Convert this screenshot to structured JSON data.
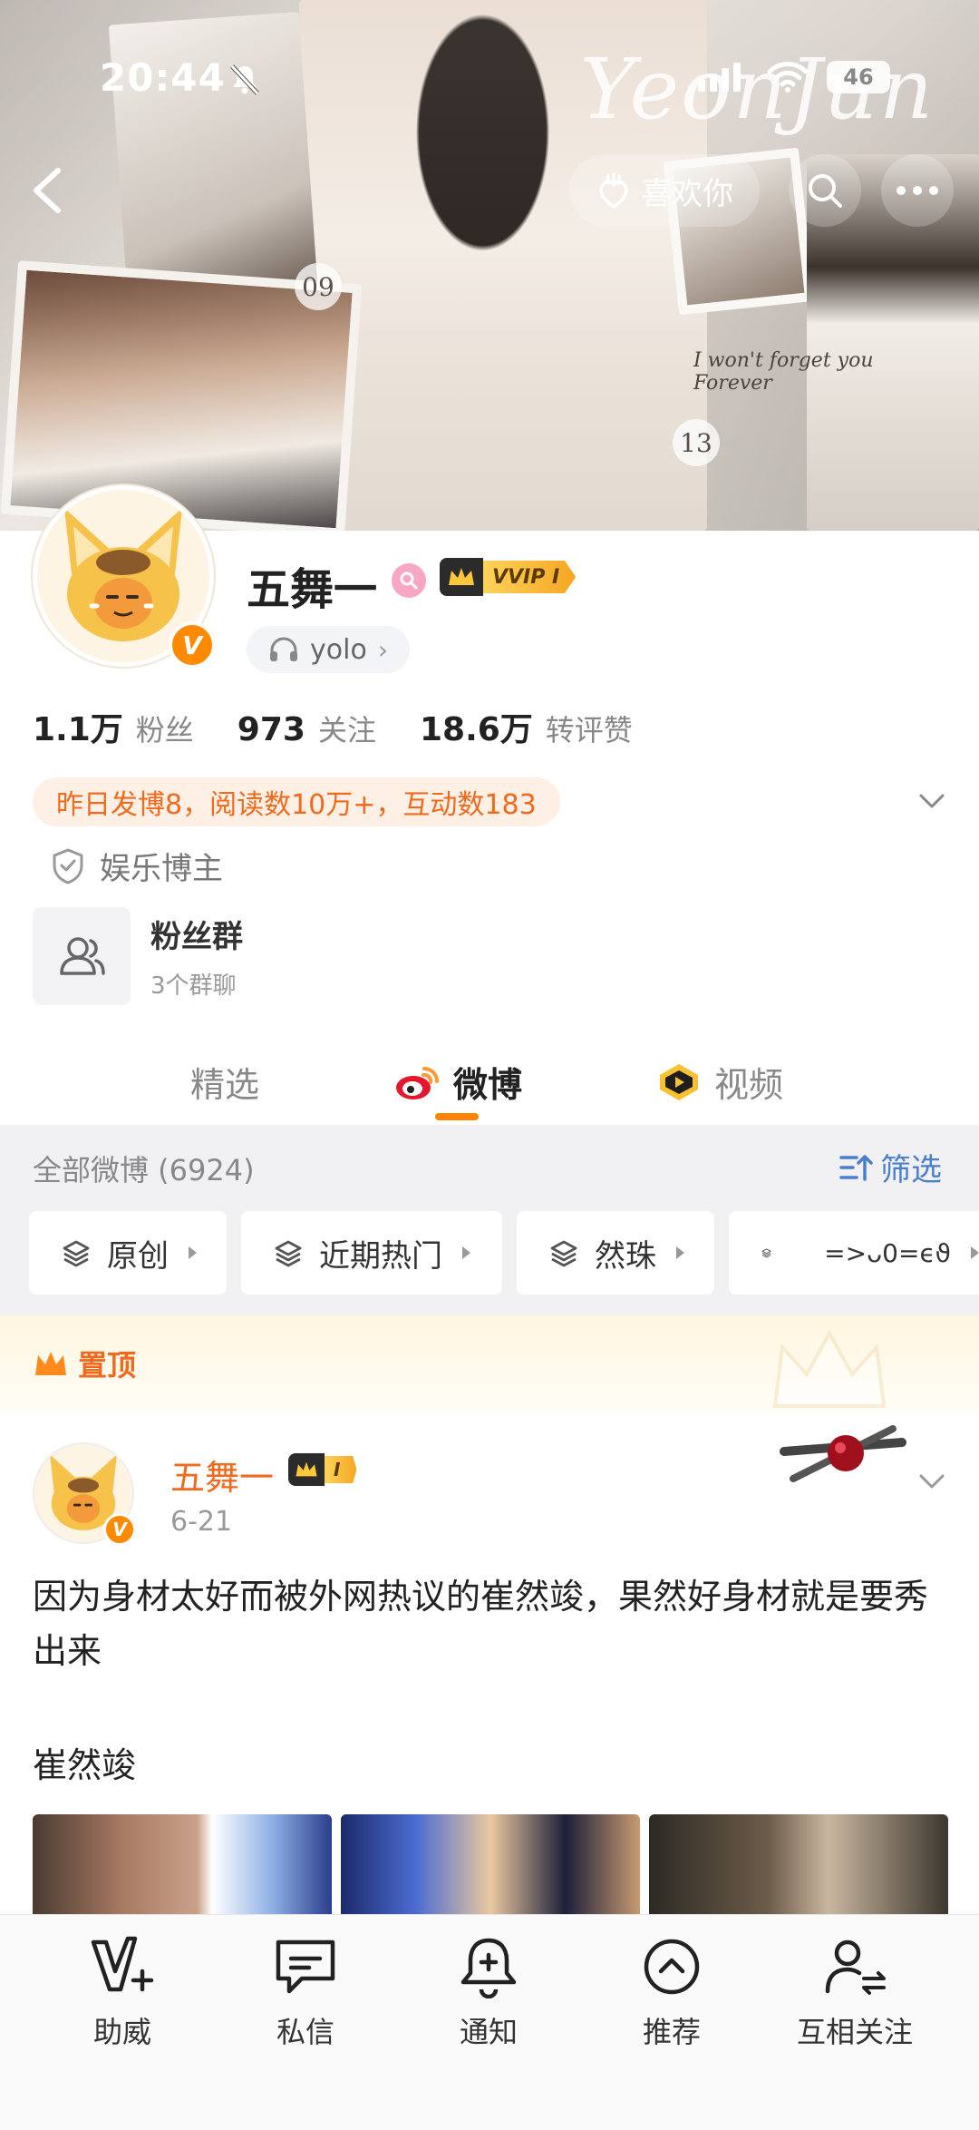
{
  "status_bar": {
    "time": "20:44",
    "battery": "46"
  },
  "banner": {
    "signature": "YeonJun",
    "number_left": "09",
    "number_right": "13",
    "caption": "I won't forget you Forever"
  },
  "header": {
    "like_label": "喜欢你"
  },
  "profile": {
    "name": "五舞一",
    "vip_label": "VVIP I",
    "music_chip": "yolo",
    "stats": [
      {
        "value": "1.1万",
        "label": "粉丝"
      },
      {
        "value": "973",
        "label": "关注"
      },
      {
        "value": "18.6万",
        "label": "转评赞"
      }
    ],
    "activity": "昨日发博8，阅读数10万+，互动数183",
    "role": "娱乐博主",
    "fans_group": {
      "title": "粉丝群",
      "subtitle": "3个群聊"
    }
  },
  "tabs": [
    {
      "label": "精选"
    },
    {
      "label": "微博"
    },
    {
      "label": "视频"
    }
  ],
  "feed": {
    "count_label": "全部微博 (6924)",
    "filter_label": "筛选",
    "chips": [
      "原创",
      "近期热门",
      "然珠",
      "=>ᴗ0=ϵϑ"
    ]
  },
  "pinned_label": "置顶",
  "post": {
    "author": "五舞一",
    "badge": "I",
    "date": "6-21",
    "text": "因为身材太好而被外网热议的崔然竣，果然好身材就是要秀出来",
    "subtitle": "崔然竣"
  },
  "bottom_bar": [
    {
      "label": "助威",
      "icon": "v-plus-icon"
    },
    {
      "label": "私信",
      "icon": "message-icon"
    },
    {
      "label": "通知",
      "icon": "bell-plus-icon"
    },
    {
      "label": "推荐",
      "icon": "chevron-up-circle-icon"
    },
    {
      "label": "互相关注",
      "icon": "mutual-follow-icon"
    }
  ],
  "colors": {
    "accent": "#ff8200",
    "orange_text": "#f06a1d",
    "link_blue": "#4a7fcf"
  }
}
